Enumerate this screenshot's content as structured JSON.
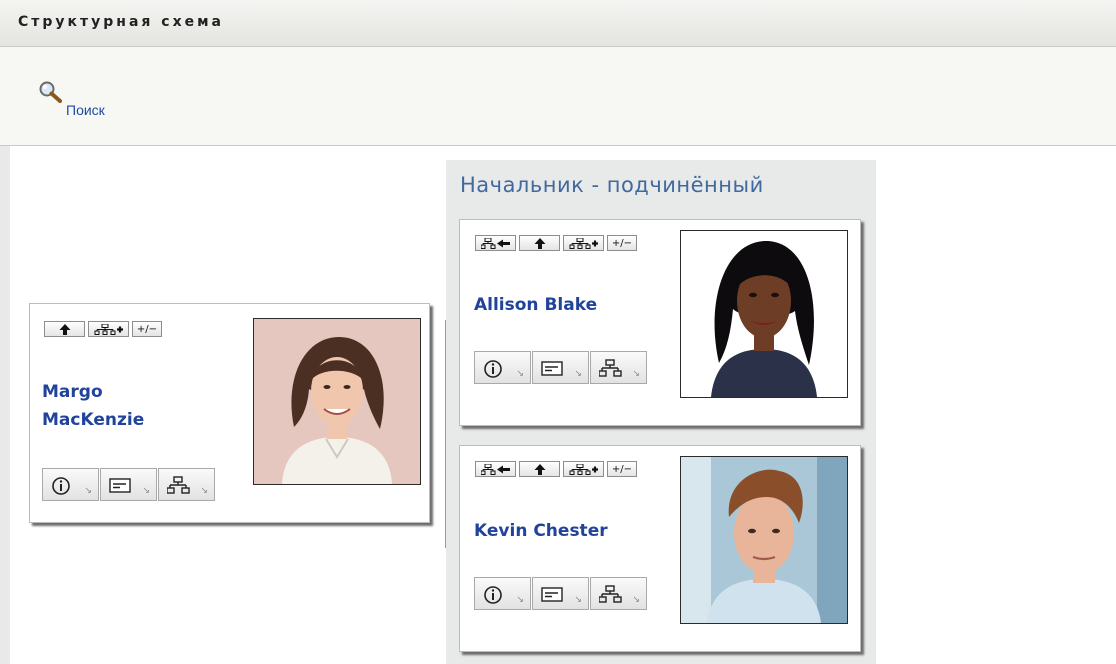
{
  "window": {
    "title": "Структурная схема"
  },
  "toolbar": {
    "search_label": "Поиск",
    "search_icon": "magnifier-icon"
  },
  "panel": {
    "title": "Начальник - подчинённый"
  },
  "mini_buttons": {
    "up": "⬆",
    "toggle": "+/−"
  },
  "people": {
    "margo": {
      "first": "Margo",
      "last": "MacKenzie"
    },
    "allison": {
      "name": "Allison Blake"
    },
    "kevin": {
      "name": "Kevin Chester"
    }
  },
  "action_icons": [
    "info-icon",
    "email-icon",
    "org-chart-icon"
  ],
  "colors": {
    "link": "#1f49a5",
    "name": "#21439a",
    "panel_title": "#41699e",
    "panel_bg": "#e8e9e9"
  }
}
